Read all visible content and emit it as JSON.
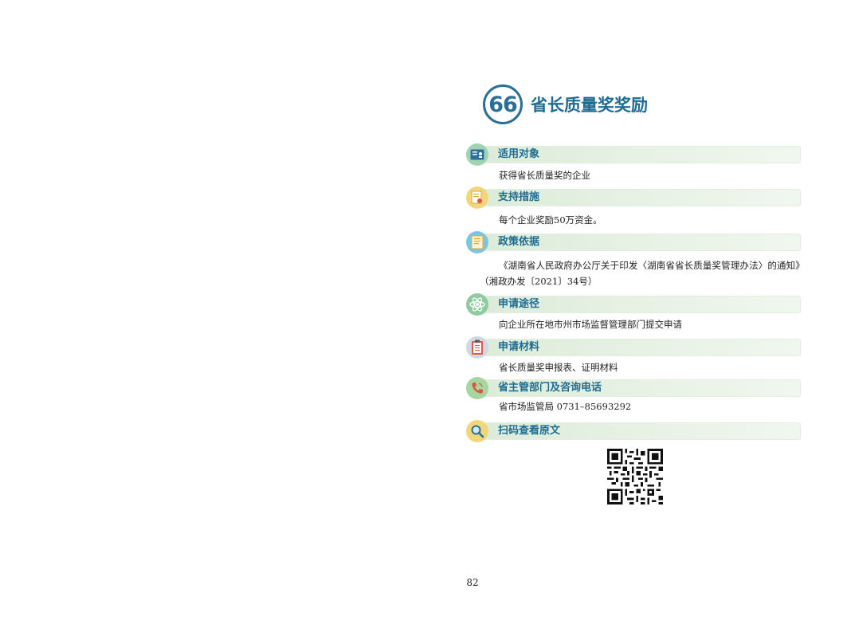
{
  "header": {
    "number": "66",
    "title": "省长质量奖奖励"
  },
  "sections": [
    {
      "icon": "id-card-icon",
      "title": "适用对象",
      "body": "获得省长质量奖的企业"
    },
    {
      "icon": "certificate-icon",
      "title": "支持措施",
      "body": "每个企业奖励50万资金。"
    },
    {
      "icon": "document-icon",
      "title": "政策依据",
      "body": "《湖南省人民政府办公厅关于印发〈湖南省省长质量奖管理办法〉的通知》（湘政办发〔2021〕34号）"
    },
    {
      "icon": "atom-icon",
      "title": "申请途径",
      "body": "向企业所在地市州市场监督管理部门提交申请"
    },
    {
      "icon": "clipboard-icon",
      "title": "申请材料",
      "body": "省长质量奖申报表、证明材料"
    },
    {
      "icon": "phone-icon",
      "title": "省主管部门及咨询电话",
      "body": "省市场监管局 0731–85693292"
    },
    {
      "icon": "magnifier-icon",
      "title": "扫码查看原文",
      "body": ""
    }
  ],
  "page_number": "82",
  "colors": {
    "title": "#1f6c93",
    "bar": "#dcecd9"
  }
}
